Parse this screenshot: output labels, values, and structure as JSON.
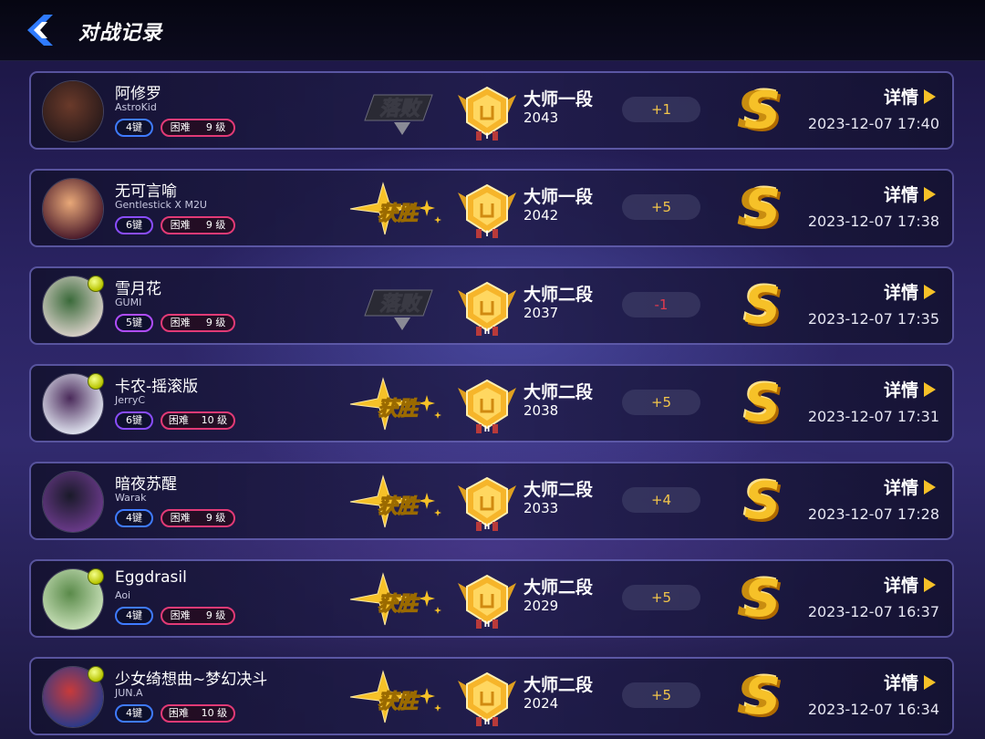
{
  "header": {
    "title": "对战记录",
    "back_icon": "chevron-left-icon"
  },
  "colors": {
    "accent": "#f6c128",
    "loss_delta": "#e23a4e",
    "key_badge": "#3f7bff",
    "diff_badge": "#e23a76"
  },
  "records": [
    {
      "title": "阿修罗",
      "artist": "AstroKid",
      "keys": "4键",
      "difficulty": "困难",
      "level": "9 级",
      "result": "落败",
      "rank": "大师一段",
      "rating": "2043",
      "delta": "+1",
      "grade": "S",
      "detail": "详情",
      "time": "2023-12-07 17:40",
      "cover": [
        "#2a1a1a",
        "#6a3a2a"
      ],
      "medal": false,
      "multi_s": true
    },
    {
      "title": "无可言喻",
      "artist": "Gentlestick X M2U",
      "keys": "6键",
      "difficulty": "困难",
      "level": "9 级",
      "result": "获胜",
      "rank": "大师一段",
      "rating": "2042",
      "delta": "+5",
      "grade": "S",
      "detail": "详情",
      "time": "2023-12-07 17:38",
      "cover": [
        "#4a1a2a",
        "#e8a878"
      ],
      "medal": false,
      "multi_s": true
    },
    {
      "title": "雪月花",
      "artist": "GUMI",
      "keys": "5键",
      "difficulty": "困难",
      "level": "9 级",
      "result": "落败",
      "rank": "大师二段",
      "rating": "2037",
      "delta": "-1",
      "grade": "S",
      "detail": "详情",
      "time": "2023-12-07 17:35",
      "cover": [
        "#d8d0c8",
        "#3a6a3a"
      ],
      "medal": true,
      "multi_s": false
    },
    {
      "title": "卡农-摇滚版",
      "artist": "JerryC",
      "keys": "6键",
      "difficulty": "困难",
      "level": "10 级",
      "result": "获胜",
      "rank": "大师二段",
      "rating": "2038",
      "delta": "+5",
      "grade": "S",
      "detail": "详情",
      "time": "2023-12-07 17:31",
      "cover": [
        "#e0e4f0",
        "#4a2a5a"
      ],
      "medal": true,
      "multi_s": false
    },
    {
      "title": "暗夜苏醒",
      "artist": "Warak",
      "keys": "4键",
      "difficulty": "困难",
      "level": "9 级",
      "result": "获胜",
      "rank": "大师二段",
      "rating": "2033",
      "delta": "+4",
      "grade": "S",
      "detail": "详情",
      "time": "2023-12-07 17:28",
      "cover": [
        "#6a3a8a",
        "#1a1a2a"
      ],
      "medal": false,
      "multi_s": false
    },
    {
      "title": "Eggdrasil",
      "artist": "Aoi",
      "keys": "4键",
      "difficulty": "困难",
      "level": "9 级",
      "result": "获胜",
      "rank": "大师二段",
      "rating": "2029",
      "delta": "+5",
      "grade": "S",
      "detail": "详情",
      "time": "2023-12-07 16:37",
      "cover": [
        "#c8e0b8",
        "#5a8a4a"
      ],
      "medal": true,
      "multi_s": true
    },
    {
      "title": "少女绮想曲~梦幻决斗",
      "artist": "JUN.A",
      "keys": "4键",
      "difficulty": "困难",
      "level": "10 级",
      "result": "获胜",
      "rank": "大师二段",
      "rating": "2024",
      "delta": "+5",
      "grade": "S",
      "detail": "详情",
      "time": "2023-12-07 16:34",
      "cover": [
        "#2a3a8a",
        "#c83a3a"
      ],
      "medal": true,
      "multi_s": true
    }
  ]
}
